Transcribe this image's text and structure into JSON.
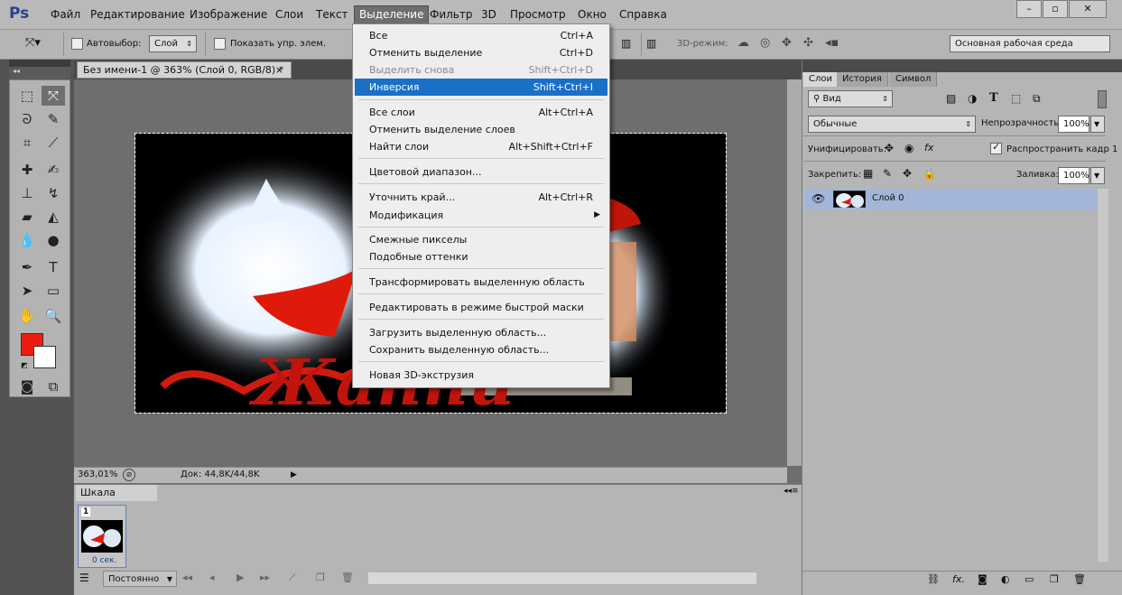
{
  "app": {
    "logo": "Ps",
    "menu": [
      "Файл",
      "Редактирование",
      "Изображение",
      "Слои",
      "Текст",
      "Выделение",
      "Фильтр",
      "3D",
      "Просмотр",
      "Окно",
      "Справка"
    ],
    "active_menu": "Выделение"
  },
  "options": {
    "autoselect_label": "Автовыбор:",
    "autoselect_value": "Слой",
    "show_controls_label": "Показать упр. элем.",
    "mode_3d_label": "3D-режим:",
    "workspace": "Основная рабочая среда"
  },
  "document": {
    "tab_title": "Без имени-1 @ 363% (Слой 0, RGB/8) *",
    "zoom": "363,01%",
    "doc_info": "Док: 44,8K/44,8K"
  },
  "timeline": {
    "tab": "Шкала времени",
    "frame_number": "1",
    "frame_delay": "0 сек.",
    "loop": "Постоянно"
  },
  "layers_panel": {
    "tabs": [
      "Слои",
      "История",
      "Символ"
    ],
    "filter": "Вид",
    "blend_mode": "Обычные",
    "opacity_label": "Непрозрачность:",
    "opacity_value": "100%",
    "unify_label": "Унифицировать:",
    "propagate_label": "Распространить кадр 1",
    "lock_label": "Закрепить:",
    "fill_label": "Заливка:",
    "fill_value": "100%",
    "layer_name": "Слой 0"
  },
  "dropdown": {
    "items": [
      {
        "label": "Все",
        "shortcut": "Ctrl+A"
      },
      {
        "label": "Отменить выделение",
        "shortcut": "Ctrl+D"
      },
      {
        "label": "Выделить снова",
        "shortcut": "Shift+Ctrl+D"
      },
      {
        "label": "Инверсия",
        "shortcut": "Shift+Ctrl+I"
      },
      {
        "label": "Все слои",
        "shortcut": "Alt+Ctrl+A"
      },
      {
        "label": "Отменить выделение слоев",
        "shortcut": ""
      },
      {
        "label": "Найти слои",
        "shortcut": "Alt+Shift+Ctrl+F"
      },
      {
        "label": "Цветовой диапазон...",
        "shortcut": ""
      },
      {
        "label": "Уточнить край...",
        "shortcut": "Alt+Ctrl+R"
      },
      {
        "label": "Модификация",
        "shortcut": ""
      },
      {
        "label": "Смежные пикселы",
        "shortcut": ""
      },
      {
        "label": "Подобные оттенки",
        "shortcut": ""
      },
      {
        "label": "Трансформировать выделенную область",
        "shortcut": ""
      },
      {
        "label": "Редактировать в режиме быстрой маски",
        "shortcut": ""
      },
      {
        "label": "Загрузить выделенную область...",
        "shortcut": ""
      },
      {
        "label": "Сохранить выделенную область...",
        "shortcut": ""
      },
      {
        "label": "Новая 3D-экструзия",
        "shortcut": ""
      }
    ]
  },
  "colors": {
    "foreground": "#ee1c10",
    "background": "#ffffff",
    "menu_highlight": "#1a6fc7"
  }
}
